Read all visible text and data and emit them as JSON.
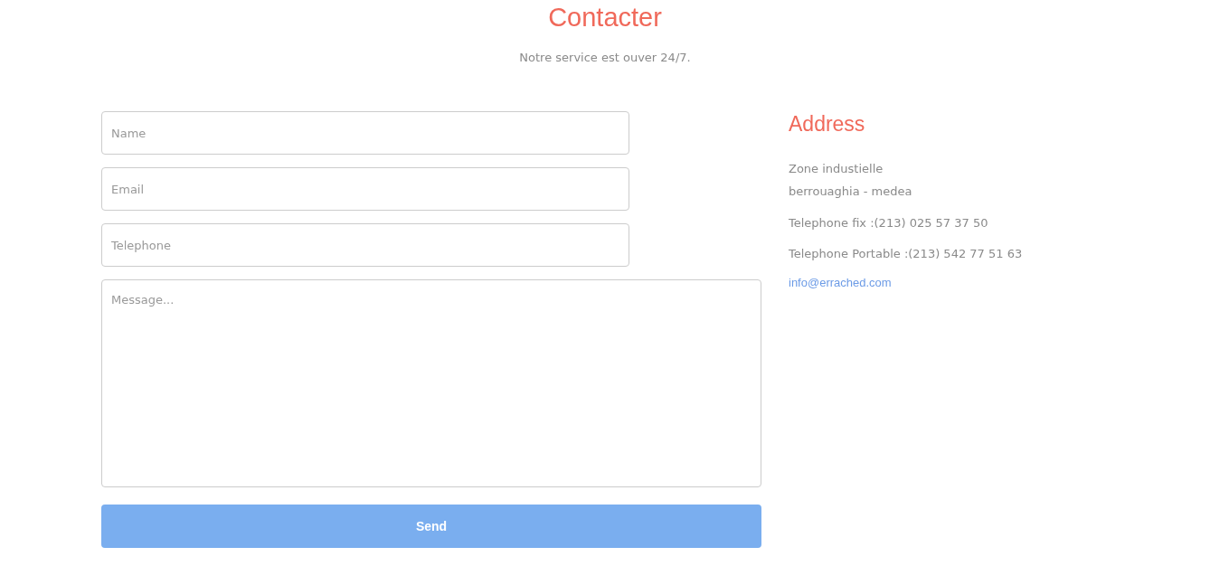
{
  "header": {
    "title": "Contacter",
    "subtitle": "Notre service est ouver 24/7."
  },
  "form": {
    "fields": [
      {
        "kind": "input",
        "placeholder": "Name"
      },
      {
        "kind": "input",
        "placeholder": "Email"
      },
      {
        "kind": "input",
        "placeholder": "Telephone"
      },
      {
        "kind": "textarea",
        "placeholder": "Message..."
      }
    ],
    "submit": "Send"
  },
  "address": {
    "title": "Address",
    "lines": [
      "Zone industielle",
      "berrouaghia - medea"
    ],
    "phones": [
      "Telephone fix :(213) 025 57 37 50",
      "Telephone Portable :(213) 542 77 51 63"
    ],
    "email": "info@errached.com"
  }
}
